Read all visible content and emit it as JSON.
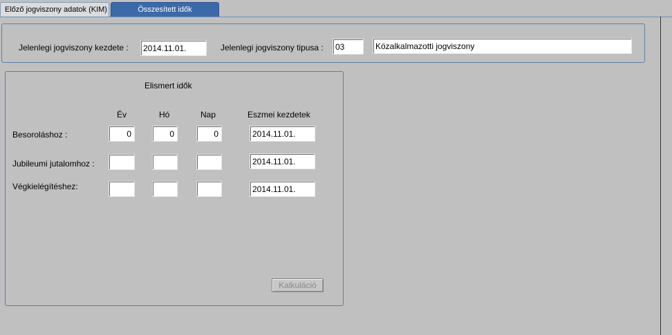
{
  "tabs": {
    "kim": "Előző jogviszony adatok (KIM)",
    "osszesitett": "Összesített idők"
  },
  "top": {
    "kezdete_label": "Jelenlegi jogviszony kezdete :",
    "kezdete_value": "2014.11.01.",
    "tipusa_label": "Jelenlegi jogviszony tipusa :",
    "tipusa_code": "03",
    "tipusa_name": "Közalkalmazotti jogviszony"
  },
  "elismert": {
    "title": "Elismert idők",
    "headers": {
      "ev": "Év",
      "ho": "Hó",
      "nap": "Nap",
      "eszmei": "Eszmei kezdetek"
    },
    "rows": [
      {
        "label": "Besoroláshoz :",
        "ev": "0",
        "ho": "0",
        "nap": "0",
        "eszmei": "2014.11.01."
      },
      {
        "label": "Jubileumi jutalomhoz :",
        "ev": "",
        "ho": "",
        "nap": "",
        "eszmei": "2014.11.01."
      },
      {
        "label": "Végkielégítéshez:",
        "ev": "",
        "ho": "",
        "nap": "",
        "eszmei": "2014.11.01."
      }
    ],
    "calc_button": "Kalkuláció"
  }
}
